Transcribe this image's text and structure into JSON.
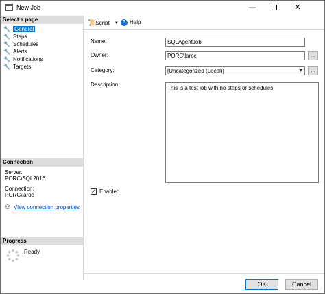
{
  "window": {
    "title": "New Job",
    "minimize": "—",
    "close": "✕"
  },
  "left": {
    "select_page_header": "Select a page",
    "pages": [
      {
        "label": "General"
      },
      {
        "label": "Steps"
      },
      {
        "label": "Schedules"
      },
      {
        "label": "Alerts"
      },
      {
        "label": "Notifications"
      },
      {
        "label": "Targets"
      }
    ],
    "connection_header": "Connection",
    "server_label": "Server:",
    "server_value": "PORC\\SQL2016",
    "connection_label": "Connection:",
    "connection_value": "PORC\\laroc",
    "view_props_link": "View connection properties",
    "progress_header": "Progress",
    "progress_status": "Ready"
  },
  "toolbar": {
    "script_label": "Script",
    "help_label": "Help"
  },
  "form": {
    "name_label": "Name:",
    "name_value": "SQLAgentJob",
    "owner_label": "Owner:",
    "owner_value": "PORC\\laroc",
    "category_label": "Category:",
    "category_value": "[Uncategorized (Local)]",
    "description_label": "Description:",
    "description_value": "This is a test job with no steps or schedules.",
    "enabled_label": "Enabled",
    "enabled_checked": true,
    "ellipsis": "..."
  },
  "buttons": {
    "ok": "OK",
    "cancel": "Cancel"
  },
  "colors": {
    "selection": "#0078d7",
    "link": "#0645ad",
    "section_header": "#dcdcdc"
  }
}
